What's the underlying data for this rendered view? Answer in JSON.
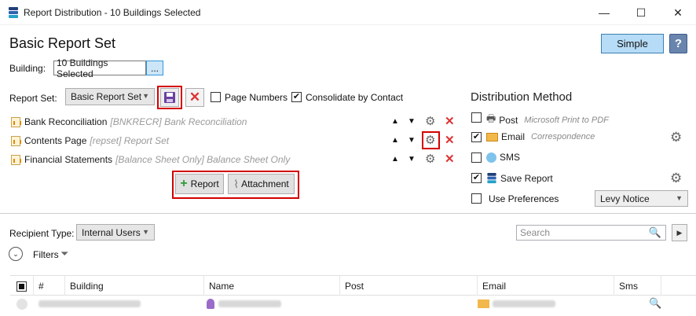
{
  "window": {
    "title": "Report Distribution - 10 Buildings Selected",
    "minimize": "—",
    "maximize": "☐",
    "close": "✕"
  },
  "header": {
    "title": "Basic Report Set",
    "simple_label": "Simple",
    "help_label": "?"
  },
  "building": {
    "label": "Building:",
    "value": "10 Buildings Selected",
    "browse_label": "..."
  },
  "report_set": {
    "label": "Report Set:",
    "selected": "Basic Report Set",
    "page_numbers_label": "Page Numbers",
    "page_numbers_checked": false,
    "consolidate_label": "Consolidate by Contact",
    "consolidate_checked": true
  },
  "reports": [
    {
      "name": "Bank Reconciliation",
      "detail": "[BNKRECR] Bank Reconciliation"
    },
    {
      "name": "Contents Page",
      "detail": "[repset] Report Set"
    },
    {
      "name": "Financial Statements",
      "detail": "[Balance Sheet Only] Balance Sheet Only"
    }
  ],
  "add_buttons": {
    "report_label": "Report",
    "attachment_label": "Attachment"
  },
  "distribution": {
    "title": "Distribution Method",
    "post_label": "Post",
    "post_sub": "Microsoft Print to PDF",
    "email_label": "Email",
    "email_sub": "Correspondence",
    "sms_label": "SMS",
    "save_label": "Save Report",
    "prefs_label": "Use Preferences",
    "prefs_value": "Levy Notice"
  },
  "recipients": {
    "type_label": "Recipient Type:",
    "type_value": "Internal Users",
    "search_placeholder": "Search",
    "filters_label": "Filters"
  },
  "grid": {
    "columns": [
      "#",
      "Building",
      "Name",
      "Post",
      "Email",
      "Sms"
    ]
  },
  "colors": {
    "highlight_red": "#d40000",
    "simple_button": "#b7dcf7"
  }
}
